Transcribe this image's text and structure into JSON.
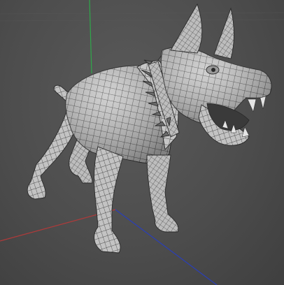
{
  "viewport": {
    "background_color": "#4d4d4d",
    "axes": {
      "x_color": "#b03a3a",
      "y_color": "#2fa84a",
      "z_color": "#2a3fb8"
    },
    "grid_color": "#5c5c5c",
    "model": {
      "subject": "dog",
      "display": "wireframe-on-shaded",
      "mesh_fill": "#c8c8c8",
      "wire_color": "#2a2a2a",
      "collar_color": "#6a6a6a"
    }
  }
}
